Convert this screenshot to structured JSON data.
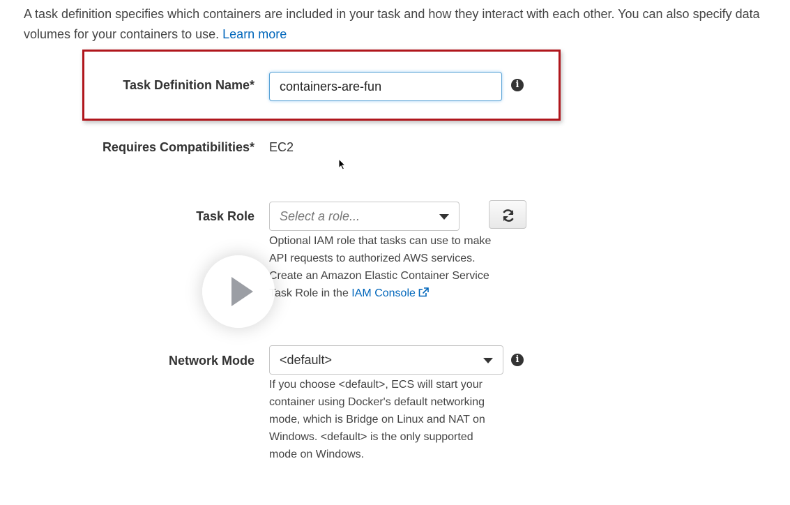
{
  "intro": {
    "text": "A task definition specifies which containers are included in your task and how they interact with each other. You can also specify data volumes for your containers to use.",
    "learn_more": "Learn more"
  },
  "task_definition_name": {
    "label": "Task Definition Name*",
    "value": "containers-are-fun",
    "info_icon": "info-icon"
  },
  "requires_compatibilities": {
    "label": "Requires Compatibilities*",
    "value": "EC2"
  },
  "task_role": {
    "label": "Task Role",
    "placeholder": "Select a role...",
    "refresh_icon": "refresh-icon",
    "help_text": "Optional IAM role that tasks can use to make API requests to authorized AWS services. Create an Amazon Elastic Container Service Task Role in the",
    "help_link": "IAM Console",
    "link_icon": "external-link-icon"
  },
  "network_mode": {
    "label": "Network Mode",
    "value": "<default>",
    "info_icon": "info-icon",
    "help_text": "If you choose <default>, ECS will start your container using Docker's default networking mode, which is Bridge on Linux and NAT on Windows. <default> is the only supported mode on Windows."
  },
  "video": {
    "play_icon": "play-icon"
  },
  "colors": {
    "link": "#0066bb",
    "highlight_border": "#b0161c",
    "input_focus": "#59a3d6",
    "label_text": "#333333"
  }
}
